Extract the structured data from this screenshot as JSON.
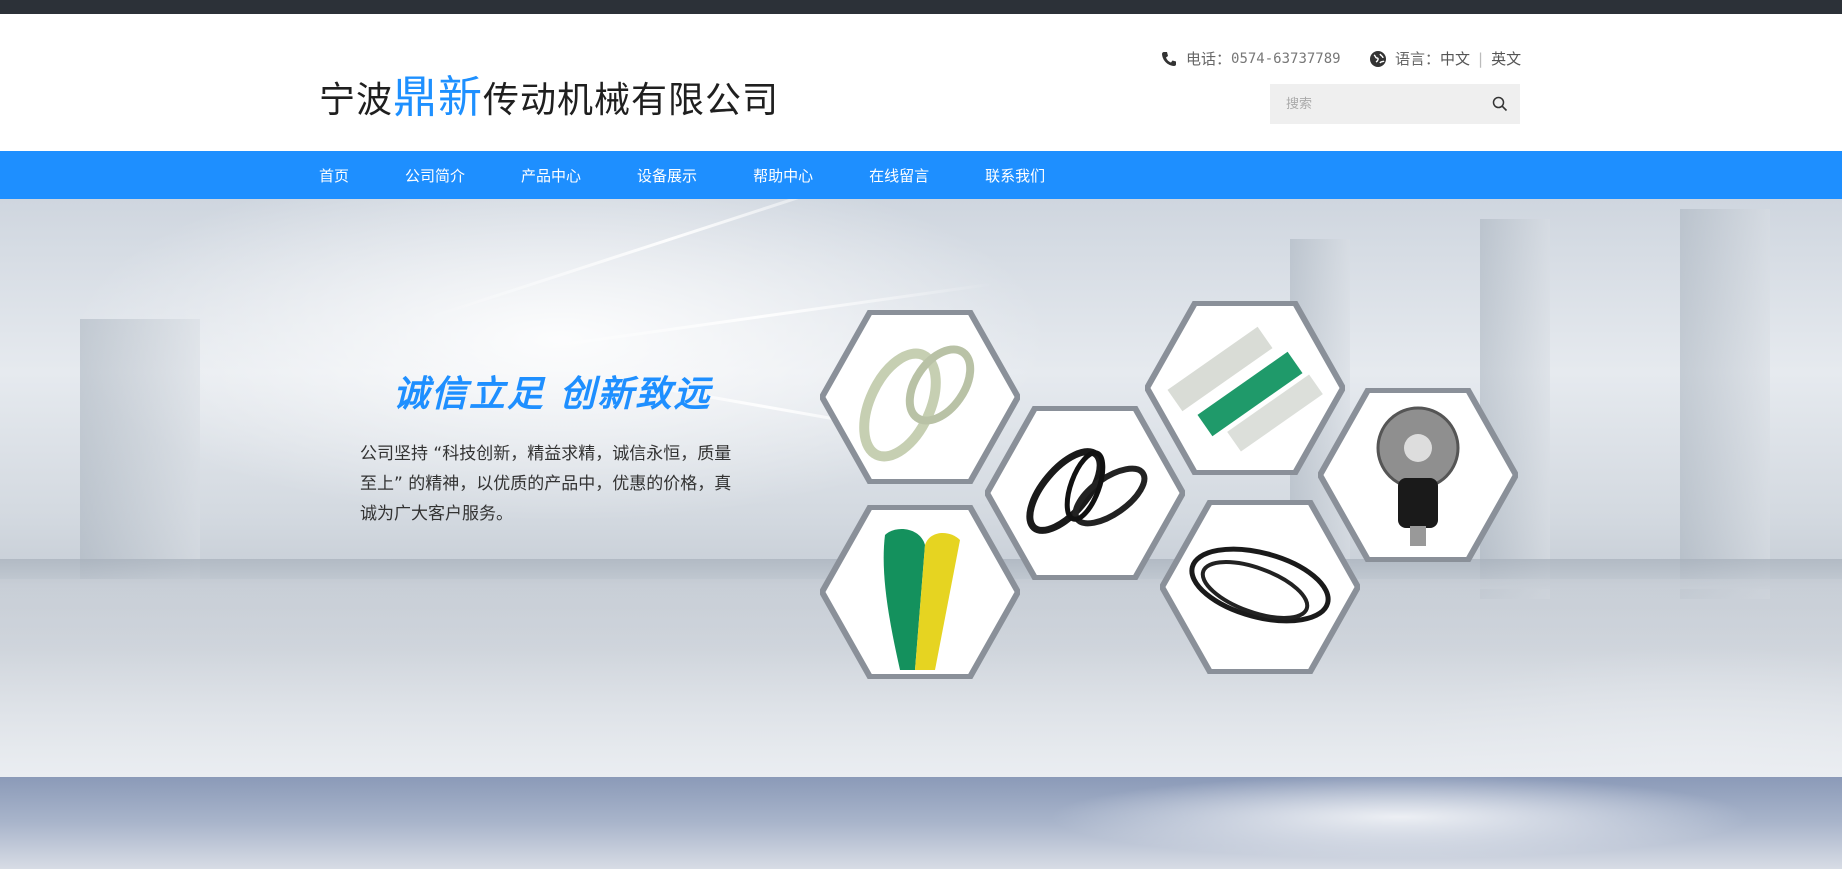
{
  "header": {
    "logo": {
      "part1": "宁波",
      "accent": "鼎新",
      "part2": "传动机械有限公司"
    },
    "phone": {
      "label": "电话：",
      "value": "0574-63737789",
      "icon": "phone-icon"
    },
    "language": {
      "label": "语言：",
      "options": [
        "中文",
        "英文"
      ],
      "icon": "globe-icon"
    },
    "search": {
      "placeholder": "搜索",
      "icon": "search-icon"
    }
  },
  "nav": {
    "items": [
      "首页",
      "公司简介",
      "产品中心",
      "设备展示",
      "帮助中心",
      "在线留言",
      "联系我们"
    ]
  },
  "hero": {
    "slogan": "诚信立足  创新致远",
    "description": "公司坚持 “科技创新，精益求精，诚信永恒，质量至上” 的精神，以优质的产品中，优惠的价格，真诚为广大客户服务。",
    "products": [
      "white-timing-belt",
      "black-v-belts",
      "belt-cleats",
      "timing-pulley-assembly",
      "green-yellow-flat-belt",
      "black-timing-belt"
    ]
  },
  "colors": {
    "accent": "#1e8fff",
    "topstrip": "#2c3138",
    "text": "#333333"
  }
}
